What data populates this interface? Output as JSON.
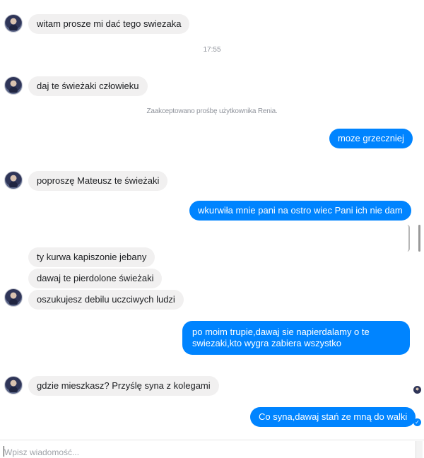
{
  "messages": {
    "m1": "witam prosze mi dać tego swiezaka",
    "time1": "17:55",
    "m2": "daj te świeżaki człowieku",
    "system1": "Zaakceptowano prośbę użytkownika Renia.",
    "m3": "moze grzeczniej",
    "m4": "poproszę Mateusz te świeżaki",
    "m5": "wkurwiła mnie pani na ostro wiec Pani ich nie dam",
    "m6": "ty kurwa kapiszonie jebany",
    "m7": "dawaj te pierdolone świeżaki",
    "m8": "oszukujesz debilu uczciwych ludzi",
    "m9_line1": "po moim trupie,dawaj sie napierdalamy o te",
    "m9_line2": "swiezaki,kto wygra zabiera wszystko",
    "m10": "gdzie mieszkasz? Przyślę syna z kolegami",
    "m11": "Co syna,dawaj stań ze mną do walki"
  },
  "composer": {
    "placeholder": "Wpisz wiadomość..."
  },
  "colors": {
    "outgoing": "#0084ff",
    "incoming": "#f1f0f0"
  }
}
